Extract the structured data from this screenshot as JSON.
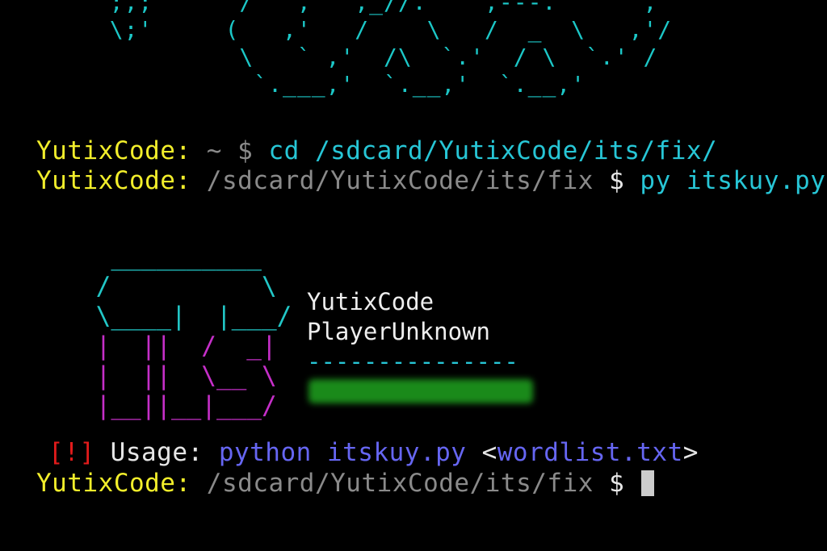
{
  "ascii_banner_top": "  ;,;      /   ,   ,_//.    ,---.      ,\n  \\;'     (   ,'   /    \\   /  _  \\   ,'/\n           \\   ` ,'  /\\  `.'  / \\  `.' /\n            `.___,'  `.__,'  `.__,'\n",
  "prompt": {
    "user": "YutixCode:",
    "home": " ~ $ ",
    "cwd": " /sdcard/YutixCode/its/fix",
    "dollar": " $ "
  },
  "commands": {
    "cd": "cd /sdcard/YutixCode/its/fix/",
    "run": "py itskuy.py"
  },
  "logo": {
    "row1": "  __________",
    "row2": " /          \\",
    "row3": " \\____|  |___/",
    "row4": " |  ||  /  _|",
    "row5": " |  ||  \\__ \\",
    "row6": " |__||__|___/"
  },
  "info": {
    "author": "YutixCode",
    "credit": "PlayerUnknown",
    "separator": "---------------"
  },
  "usage": {
    "tag": "[!]",
    "label": " Usage: ",
    "command": "python itskuy.py ",
    "arg": "<wordlist.txt>"
  }
}
